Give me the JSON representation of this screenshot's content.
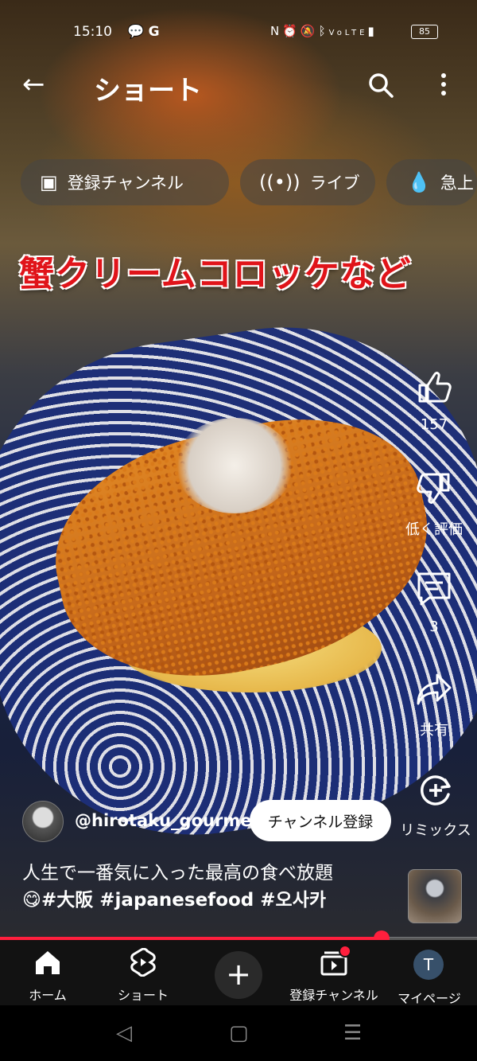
{
  "status": {
    "time": "15:10",
    "left_icons": [
      "chat-icon",
      "google-icon"
    ],
    "right_icons": [
      "nfc-icon",
      "alarm-icon",
      "mute-icon",
      "bluetooth-icon",
      "volte-icon",
      "5g-signal-icon"
    ],
    "battery": "85"
  },
  "header": {
    "title": "ショート"
  },
  "chips": [
    {
      "label": "登録チャンネル",
      "icon": "subscriptions-icon"
    },
    {
      "label": "ライブ",
      "icon": "live-icon"
    },
    {
      "label": "急上",
      "icon": "trending-icon"
    }
  ],
  "video": {
    "overlay_caption": "蟹クリームコロッケなど"
  },
  "actions": {
    "like_count": "157",
    "dislike_label": "低く評価",
    "comment_count": "3",
    "share_label": "共有",
    "remix_label": "リミックス"
  },
  "channel": {
    "handle": "@hirotaku_gourmet",
    "subscribe_label": "チャンネル登録"
  },
  "description": {
    "line1": "人生で一番気に入った最高の食べ放題",
    "emoji": "😋",
    "tags": "#大阪 #japanesefood #오사카"
  },
  "progress": {
    "fraction": 0.8
  },
  "colors": {
    "accent": "#ff1f3d",
    "overlay_text": "#e0141a"
  },
  "bottom_nav": {
    "home": "ホーム",
    "shorts": "ショート",
    "subscriptions": "登録チャンネル",
    "mypage": "マイページ",
    "avatar_letter": "T"
  }
}
